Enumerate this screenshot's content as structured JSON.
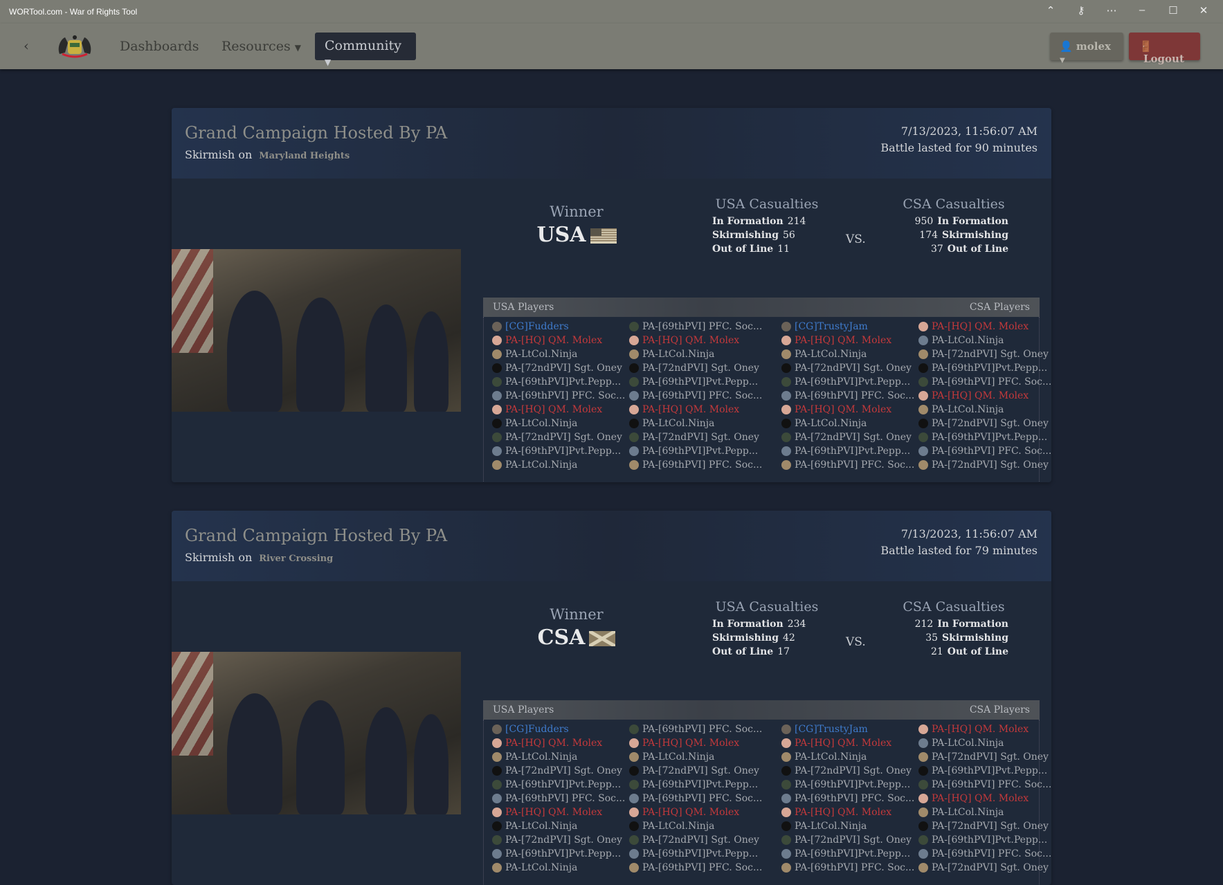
{
  "window": {
    "title": "WORTool.com - War of Rights Tool",
    "controls": [
      "chevron-up-icon",
      "key-icon",
      "more-icon",
      "minimize-icon",
      "maximize-icon",
      "close-icon"
    ]
  },
  "nav": {
    "dashboards": "Dashboards",
    "resources": "Resources",
    "community": "Community",
    "user": "molex",
    "logout": "Logout"
  },
  "colors": {
    "red": "#c4393b",
    "blue": "#3f7bcc",
    "logout": "#7e3737",
    "nav": "#7b7c74"
  },
  "battles": [
    {
      "title": "Grand Campaign Hosted By PA",
      "mode": "Skirmish on",
      "map": "Maryland Heights",
      "date": "7/13/2023, 11:56:07 AM",
      "duration": "Battle lasted for 90 minutes",
      "winner_label": "Winner",
      "winner": "USA",
      "usa_title": "USA Casualties",
      "csa_title": "CSA Casualties",
      "vs": "VS.",
      "usa": [
        {
          "label": "In Formation",
          "value": "214"
        },
        {
          "label": "Skirmishing",
          "value": "56"
        },
        {
          "label": "Out of Line",
          "value": "11"
        }
      ],
      "csa": [
        {
          "label": "In Formation",
          "value": "950"
        },
        {
          "label": "Skirmishing",
          "value": "174"
        },
        {
          "label": "Out of Line",
          "value": "37"
        }
      ],
      "usa_players_label": "USA Players",
      "csa_players_label": "CSA Players"
    },
    {
      "title": "Grand Campaign Hosted By PA",
      "mode": "Skirmish on",
      "map": "River Crossing",
      "date": "7/13/2023, 11:56:07 AM",
      "duration": "Battle lasted for 79 minutes",
      "winner_label": "Winner",
      "winner": "CSA",
      "usa_title": "USA Casualties",
      "csa_title": "CSA Casualties",
      "vs": "VS.",
      "usa": [
        {
          "label": "In Formation",
          "value": "234"
        },
        {
          "label": "Skirmishing",
          "value": "42"
        },
        {
          "label": "Out of Line",
          "value": "17"
        }
      ],
      "csa": [
        {
          "label": "In Formation",
          "value": "212"
        },
        {
          "label": "Skirmishing",
          "value": "35"
        },
        {
          "label": "Out of Line",
          "value": "21"
        }
      ],
      "usa_players_label": "USA Players",
      "csa_players_label": "CSA Players"
    }
  ],
  "player_columns": [
    [
      [
        "[CG]Fudders",
        "blue"
      ],
      [
        "PA-[HQ] QM. Molex",
        "red"
      ],
      [
        "PA-LtCol.Ninja",
        "gray"
      ],
      [
        "PA-[72ndPVI] Sgt. Oney",
        "gray"
      ],
      [
        "PA-[69thPVI]Pvt.Pepp...",
        "gray"
      ],
      [
        "PA-[69thPVI] PFC. Soc...",
        "gray"
      ],
      [
        "PA-[HQ] QM. Molex",
        "red"
      ],
      [
        "PA-LtCol.Ninja",
        "gray"
      ],
      [
        "PA-[72ndPVI] Sgt. Oney",
        "gray"
      ],
      [
        "PA-[69thPVI]Pvt.Pepp...",
        "gray"
      ],
      [
        "PA-LtCol.Ninja",
        "gray"
      ]
    ],
    [
      [
        "PA-[69thPVI] PFC. Soc...",
        "gray"
      ],
      [
        "PA-[HQ] QM. Molex",
        "red"
      ],
      [
        "PA-LtCol.Ninja",
        "gray"
      ],
      [
        "PA-[72ndPVI] Sgt. Oney",
        "gray"
      ],
      [
        "PA-[69thPVI]Pvt.Pepp...",
        "gray"
      ],
      [
        "PA-[69thPVI] PFC. Soc...",
        "gray"
      ],
      [
        "PA-[HQ] QM. Molex",
        "red"
      ],
      [
        "PA-LtCol.Ninja",
        "gray"
      ],
      [
        "PA-[72ndPVI] Sgt. Oney",
        "gray"
      ],
      [
        "PA-[69thPVI]Pvt.Pepp...",
        "gray"
      ],
      [
        "PA-[69thPVI] PFC. Soc...",
        "gray"
      ]
    ],
    [
      [
        "[CG]TrustyJam",
        "blue"
      ],
      [
        "PA-[HQ] QM. Molex",
        "red"
      ],
      [
        "PA-LtCol.Ninja",
        "gray"
      ],
      [
        "PA-[72ndPVI] Sgt. Oney",
        "gray"
      ],
      [
        "PA-[69thPVI]Pvt.Pepp...",
        "gray"
      ],
      [
        "PA-[69thPVI] PFC. Soc...",
        "gray"
      ],
      [
        "PA-[HQ] QM. Molex",
        "red"
      ],
      [
        "PA-LtCol.Ninja",
        "gray"
      ],
      [
        "PA-[72ndPVI] Sgt. Oney",
        "gray"
      ],
      [
        "PA-[69thPVI]Pvt.Pepp...",
        "gray"
      ],
      [
        "PA-[69thPVI] PFC. Soc...",
        "gray"
      ]
    ],
    [
      [
        "PA-[HQ] QM. Molex",
        "red"
      ],
      [
        "PA-LtCol.Ninja",
        "gray"
      ],
      [
        "PA-[72ndPVI] Sgt. Oney",
        "gray"
      ],
      [
        "PA-[69thPVI]Pvt.Pepp...",
        "gray"
      ],
      [
        "PA-[69thPVI] PFC. Soc...",
        "gray"
      ],
      [
        "PA-[HQ] QM. Molex",
        "red"
      ],
      [
        "PA-LtCol.Ninja",
        "gray"
      ],
      [
        "PA-[72ndPVI] Sgt. Oney",
        "gray"
      ],
      [
        "PA-[69thPVI]Pvt.Pepp...",
        "gray"
      ],
      [
        "PA-[69thPVI] PFC. Soc...",
        "gray"
      ],
      [
        "PA-[72ndPVI] Sgt. Oney",
        "gray"
      ]
    ]
  ]
}
